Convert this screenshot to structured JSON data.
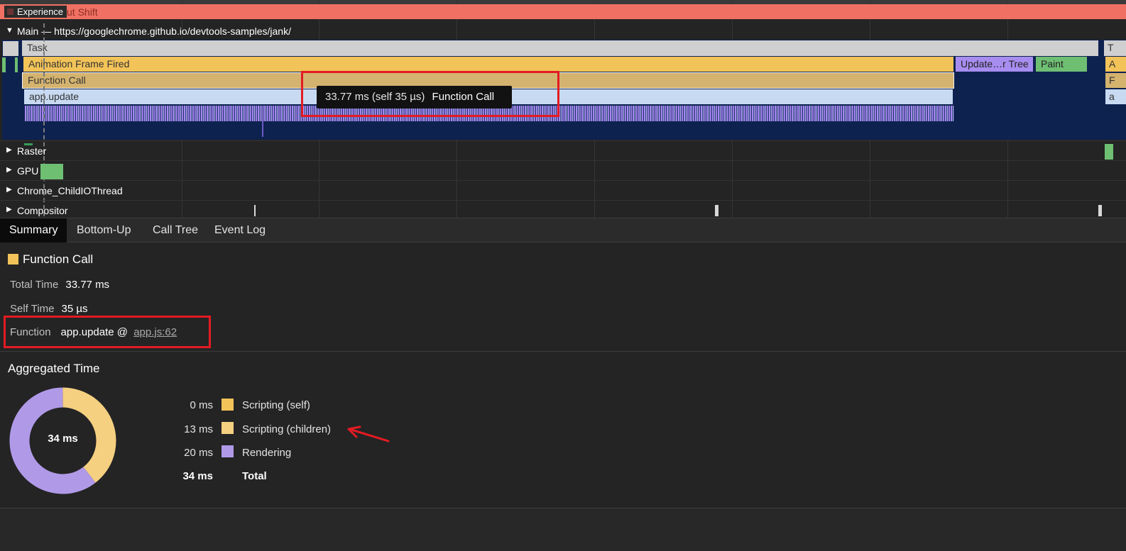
{
  "timeline": {
    "experience_label": "Experience",
    "experience_ghost_text": "ut Shift",
    "main_title": "Main — https://googlechrome.github.io/devtools-samples/jank/",
    "events": {
      "task": "Task",
      "task_right": "T",
      "animation_frame": "Animation Frame Fired",
      "animation_right": "A",
      "function_call": "Function Call",
      "function_right": "F",
      "app_update": "app.update",
      "app_right": "a",
      "update_layer_tree": "Update…r Tree",
      "paint": "Paint"
    },
    "tooltip": {
      "time": "33.77 ms (self 35 µs)",
      "name": "Function Call"
    },
    "threads": [
      "Raster",
      "GPU",
      "Chrome_ChildIOThread",
      "Compositor"
    ]
  },
  "tabs": [
    "Summary",
    "Bottom-Up",
    "Call Tree",
    "Event Log"
  ],
  "summary": {
    "title": "Function Call",
    "title_color": "#f2c358",
    "total_time_label": "Total Time",
    "total_time_value": "33.77 ms",
    "self_time_label": "Self Time",
    "self_time_value": "35 µs",
    "function_label": "Function",
    "function_name": "app.update @",
    "function_link": "app.js:62"
  },
  "aggregated": {
    "title": "Aggregated Time",
    "center_label": "34 ms",
    "rows": [
      {
        "value": "0 ms",
        "label": "Scripting (self)",
        "color": "#f2c358",
        "ms": 0.035
      },
      {
        "value": "13 ms",
        "label": "Scripting (children)",
        "color": "#f5d080",
        "ms": 13
      },
      {
        "value": "20 ms",
        "label": "Rendering",
        "color": "#b09ae8",
        "ms": 20
      }
    ],
    "total_value": "34 ms",
    "total_label": "Total"
  }
}
